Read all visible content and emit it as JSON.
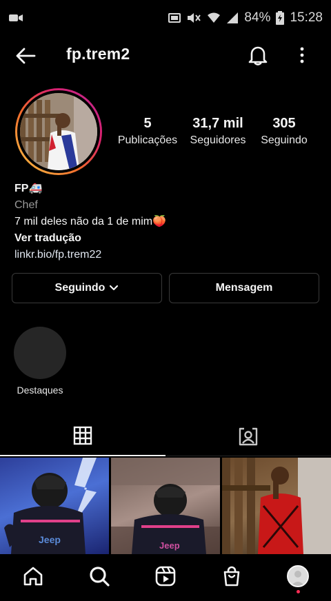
{
  "status_bar": {
    "battery": "84%",
    "time": "15:28",
    "icons": [
      "video-camera-icon",
      "cast-icon",
      "mute-icon",
      "wifi-icon",
      "signal-icon",
      "battery-icon"
    ]
  },
  "header": {
    "username": "fp.trem2",
    "icons": [
      "back-arrow-icon",
      "bell-icon",
      "more-vertical-icon"
    ]
  },
  "profile": {
    "stats": [
      {
        "value": "5",
        "label": "Publicações"
      },
      {
        "value": "31,7 mil",
        "label": "Seguidores"
      },
      {
        "value": "305",
        "label": "Seguindo"
      }
    ],
    "bio": {
      "name": "FP🚑",
      "category": "Chef",
      "text": "7 mil deles não da 1 de mim🍑",
      "translate": "Ver tradução",
      "link": "linkr.bio/fp.trem22"
    }
  },
  "actions": {
    "following_label": "Seguindo",
    "message_label": "Mensagem"
  },
  "highlights": [
    {
      "label": "Destaques"
    }
  ],
  "tabs": [
    "grid-icon",
    "tagged-icon"
  ],
  "bottom_nav": [
    "home-icon",
    "search-icon",
    "reels-icon",
    "shop-icon",
    "profile-avatar"
  ],
  "colors": {
    "background": "#000000",
    "text": "#f5f5f5",
    "muted": "#9a9a9a",
    "border": "#3a3a3a",
    "notification_dot": "#ff2d55"
  }
}
